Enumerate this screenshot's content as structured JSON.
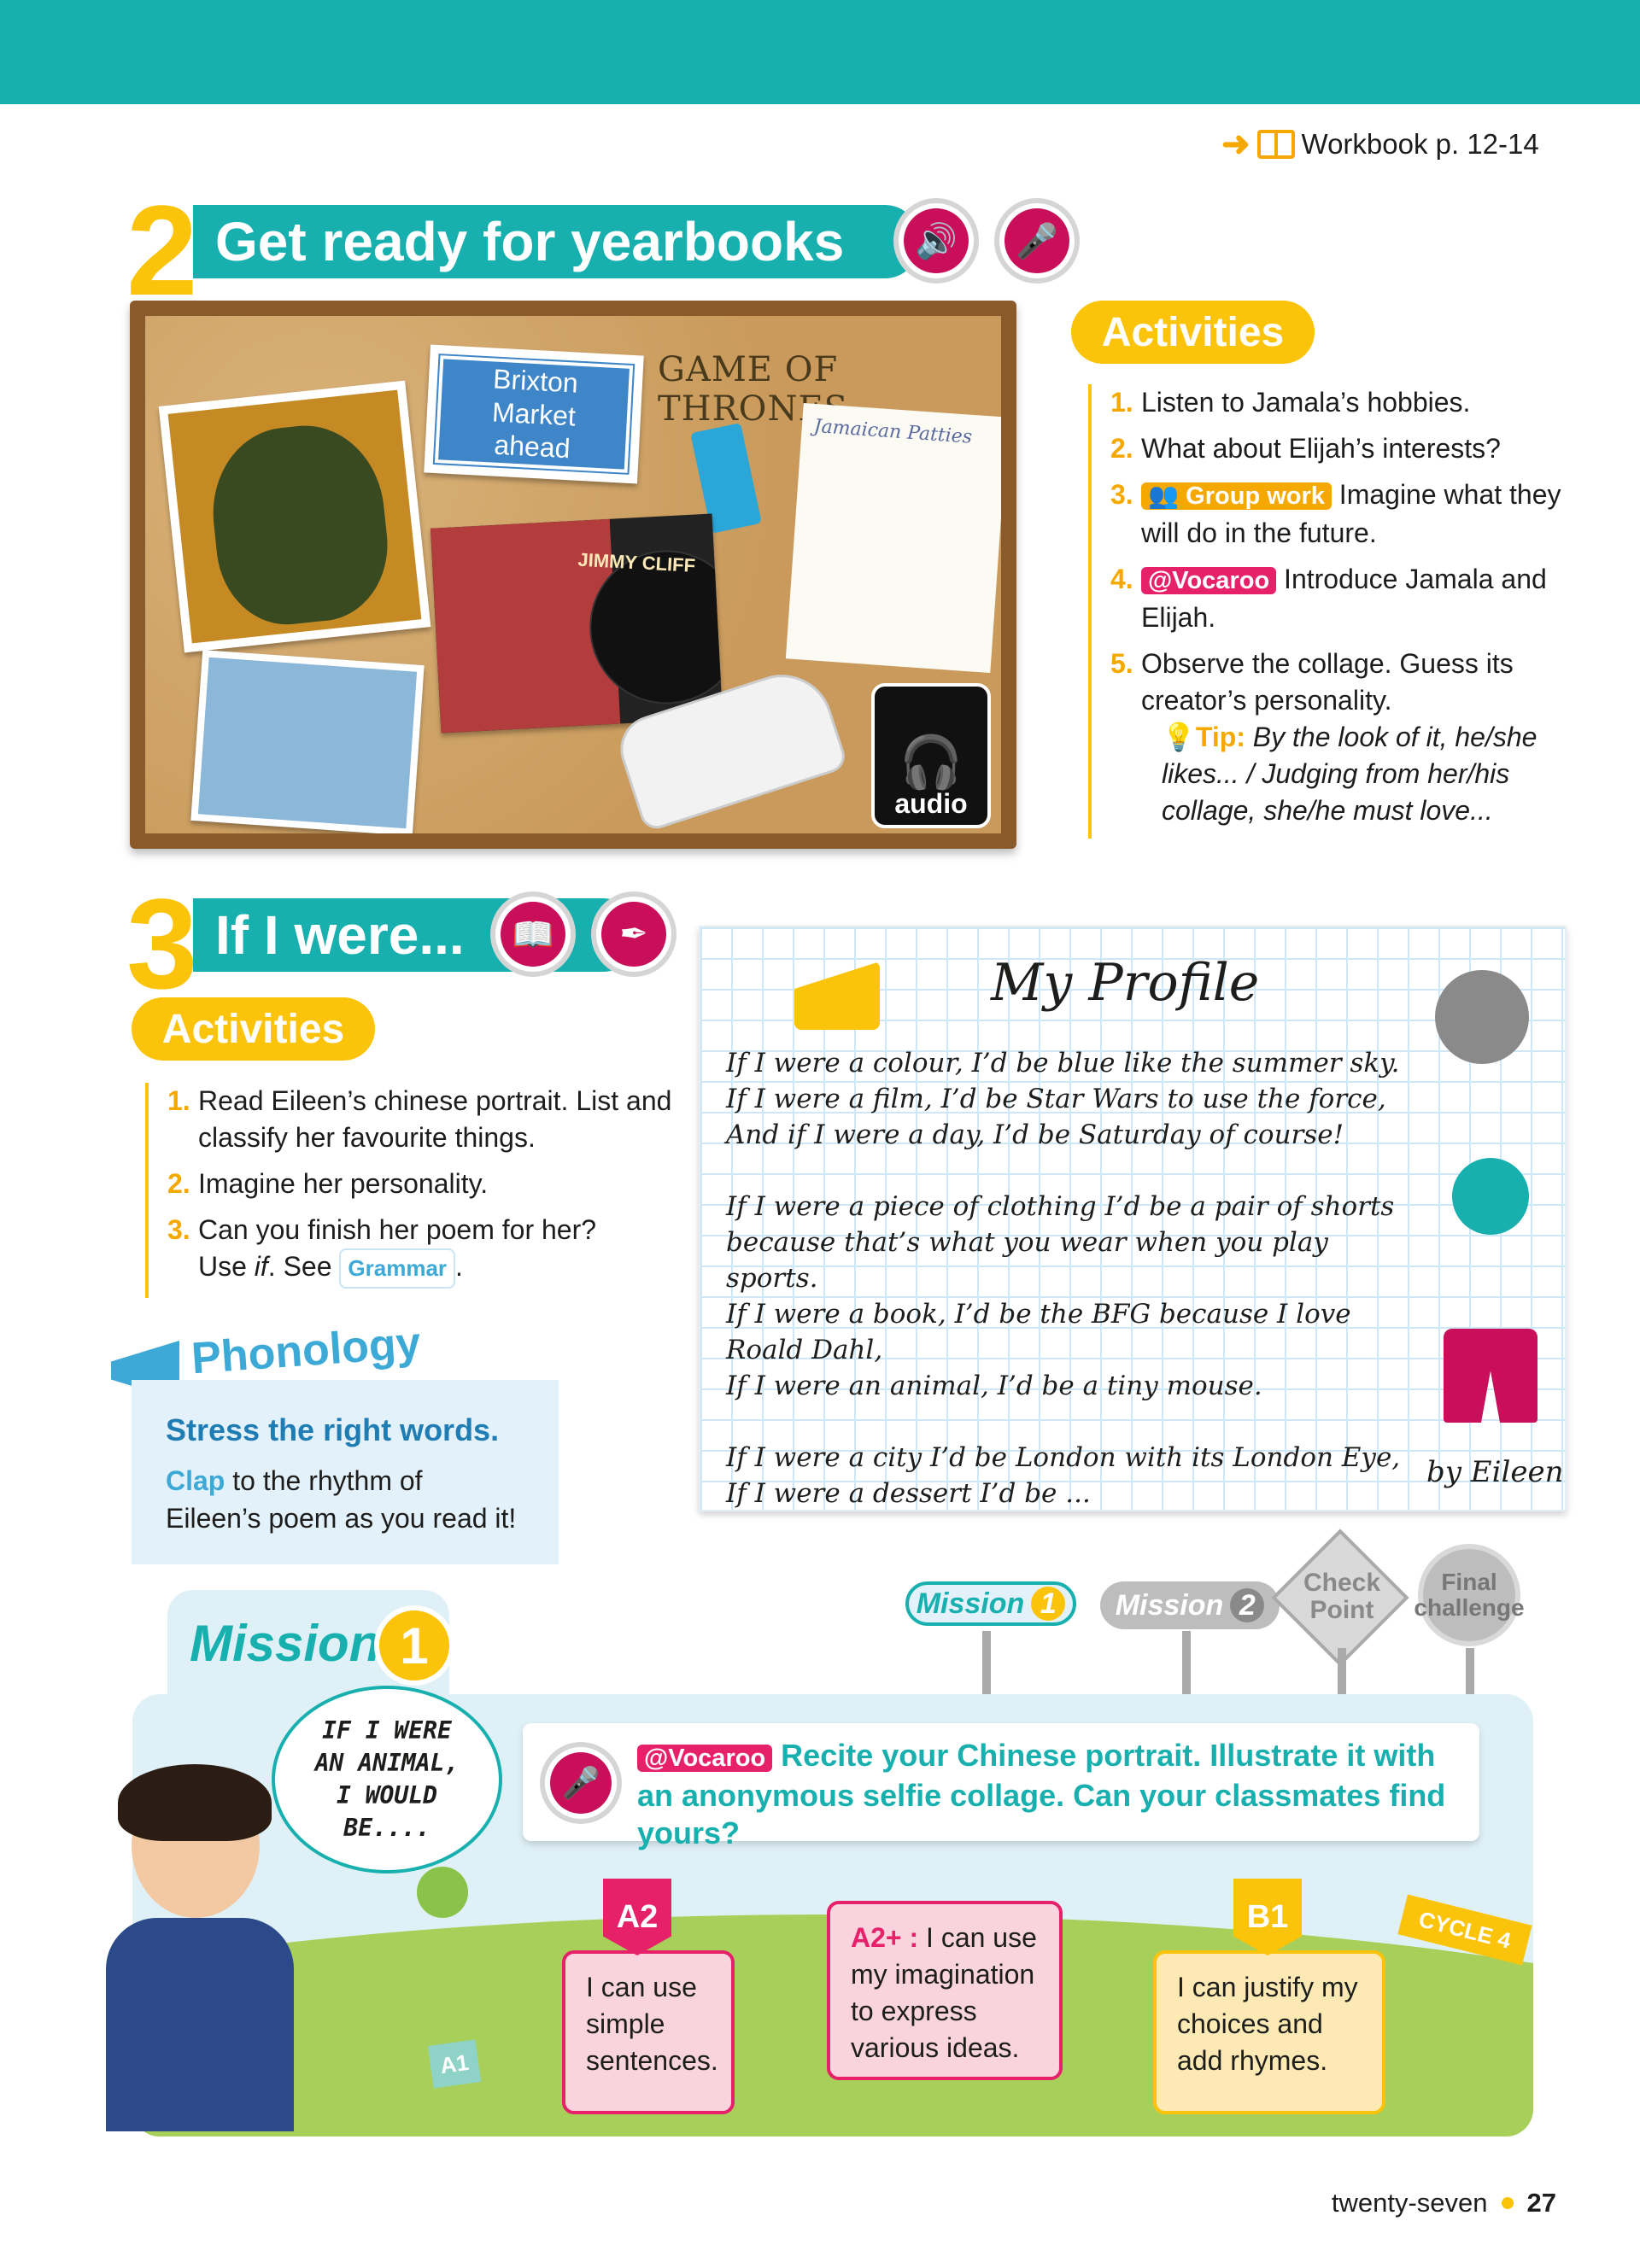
{
  "workbook": {
    "label": "Workbook p. 12-14"
  },
  "section2": {
    "number": "2",
    "title": "Get ready for yearbooks",
    "activities_label": "Activities",
    "items": [
      {
        "n": "1.",
        "text": "Listen to Jamala’s hobbies."
      },
      {
        "n": "2.",
        "text": "What about Elijah’s interests?"
      },
      {
        "n": "3.",
        "tag": "Group work",
        "text": "Imagine what they will do in the future."
      },
      {
        "n": "4.",
        "tag": "@Vocaroo",
        "text": "Introduce Jamala and Elijah."
      },
      {
        "n": "5.",
        "text": "Observe the collage. Guess its creator’s personality."
      }
    ],
    "tip_label": "Tip:",
    "tip_text": "By the look of it, he/she likes... / Judging from her/his collage, she/he must love...",
    "collage": {
      "sign": "Brixton Market ahead",
      "got": "GAME OF THRONES",
      "record": "JIMMY CLIFF",
      "note": "Jamaican Patties",
      "audio_label": "audio"
    }
  },
  "section3": {
    "number": "3",
    "title": "If I were...",
    "activities_label": "Activities",
    "items": [
      {
        "n": "1.",
        "text": "Read Eileen’s chinese portrait. List and classify her favourite things."
      },
      {
        "n": "2.",
        "text": "Imagine her personality."
      },
      {
        "n": "3.",
        "text_a": "Can you finish her poem for her?",
        "text_b": "Use",
        "text_c": "if",
        "text_d": ". See",
        "grammar": "Grammar",
        "text_e": "."
      }
    ]
  },
  "phonology": {
    "label": "Phonology",
    "heading": "Stress the right words.",
    "clap": "Clap",
    "text": "to the rhythm of Eileen’s poem as you read it!"
  },
  "profile": {
    "title": "My Profile",
    "lines": [
      "If I were a colour, I’d be blue like the summer sky.",
      "If I were a film, I’d be Star Wars to use the force,",
      "And if I were a day, I’d be Saturday of course!",
      "",
      "If I were a piece of clothing I’d be a pair of shorts",
      "because that’s what you wear when you play sports.",
      "If I were a book, I’d be the BFG because I love Roald Dahl,",
      "If I were an animal, I’d be a tiny mouse.",
      "",
      "If I were a city I’d be London with its London Eye,",
      "If I were a dessert I’d be ..."
    ],
    "signature": "by Eileen"
  },
  "mission": {
    "label": "Mission",
    "number": "1",
    "signs": [
      {
        "label": "Mission",
        "num": "1"
      },
      {
        "label": "Mission",
        "num": "2"
      },
      {
        "label": "Check Point"
      },
      {
        "label": "Final challenge"
      }
    ],
    "bubble": "IF I WERE AN ANIMAL, I WOULD BE....",
    "task_tag": "@Vocaroo",
    "task_text": "Recite your Chinese portrait. Illustrate it with an anonymous selfie collage. Can your classmates find yours?",
    "levels": [
      {
        "badge": "A2",
        "text": "I can use simple sentences."
      },
      {
        "badge": "A2+ :",
        "text": "I can use my imagination to express various ideas."
      },
      {
        "badge": "B1",
        "text": "I can justify my choices and add rhymes."
      }
    ],
    "a1": "A1",
    "cycle": "CYCLE 4"
  },
  "footer": {
    "words": "twenty-seven",
    "number": "27"
  },
  "colors": {
    "teal": "#17b0ae",
    "yellow": "#fcc30b",
    "magenta": "#c90f5a"
  }
}
